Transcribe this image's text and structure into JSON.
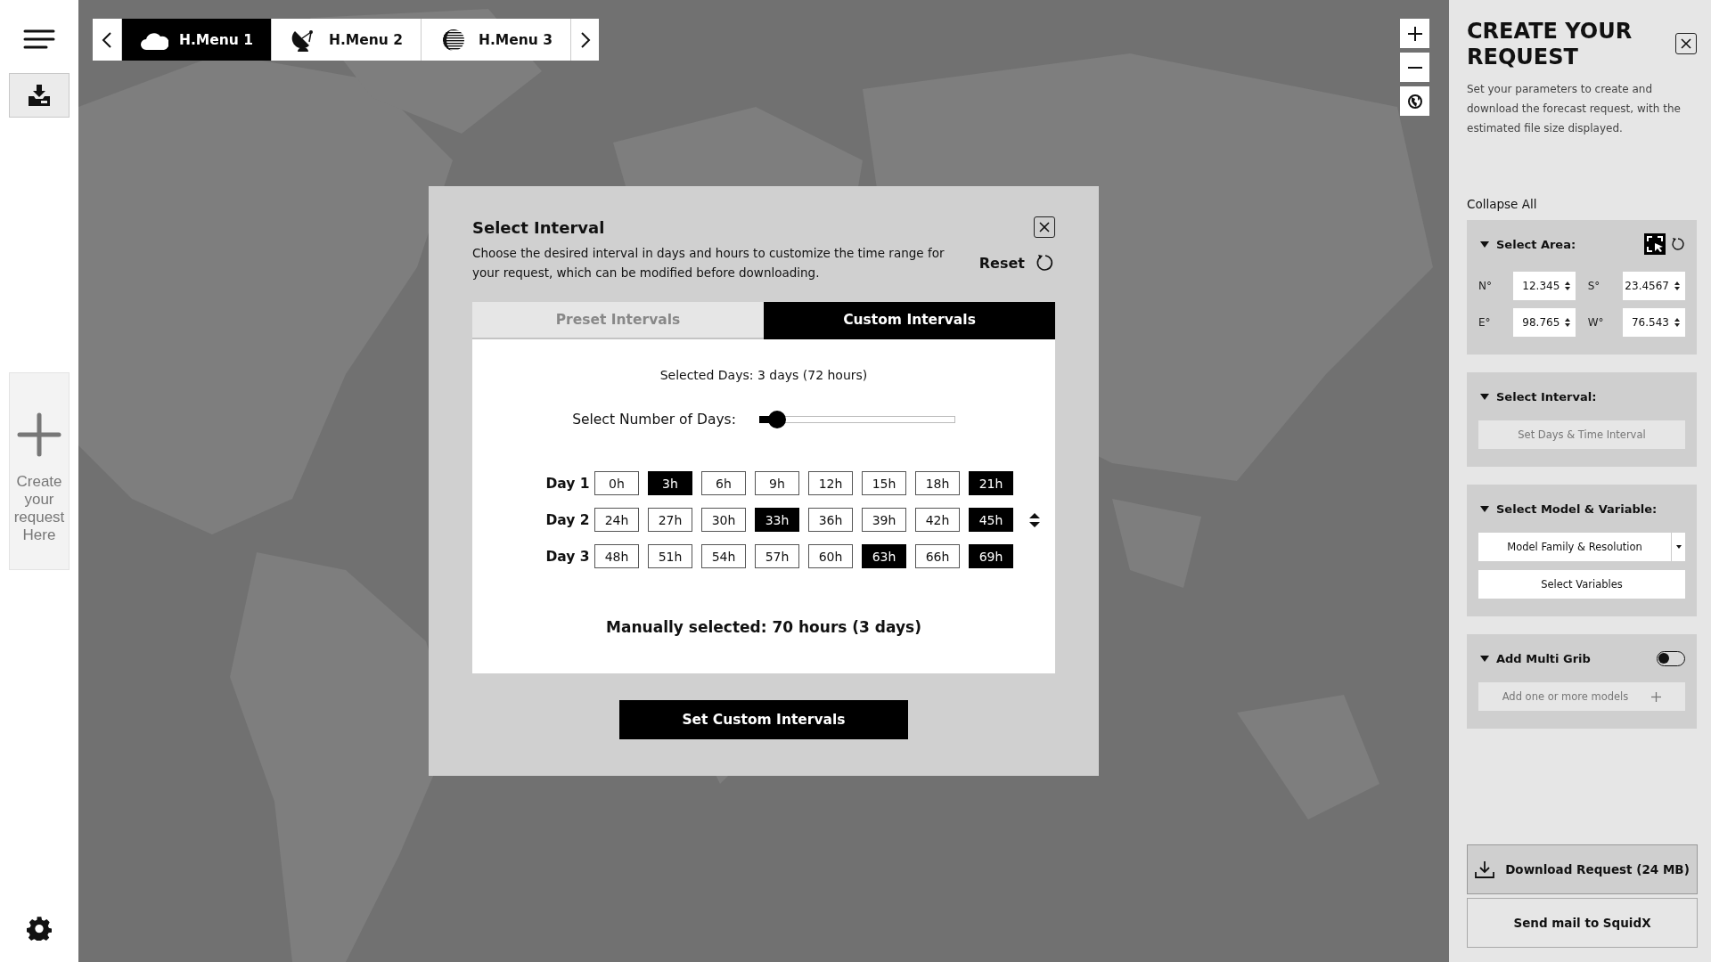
{
  "sidebar": {
    "create_card": {
      "label": "Create your request Here"
    }
  },
  "top_tabs": [
    {
      "label": "H.Menu 1",
      "selected": true
    },
    {
      "label": "H.Menu 2",
      "selected": false
    },
    {
      "label": "H.Menu 3",
      "selected": false
    }
  ],
  "modal": {
    "title": "Select Interval",
    "description": "Choose the desired interval in days and hours to customize the time range for your request, which can be modified before downloading.",
    "reset": "Reset",
    "tabs": [
      {
        "label": "Preset Intervals",
        "selected": false
      },
      {
        "label": "Custom Intervals",
        "selected": true
      }
    ],
    "selected_days": "Selected Days: 3 days (72 hours)",
    "slider": {
      "label": "Select Number of Days:",
      "level": 0.09
    },
    "days": [
      {
        "label": "Day 1",
        "hours": [
          {
            "label": "0h",
            "selected": false
          },
          {
            "label": "3h",
            "selected": true
          },
          {
            "label": "6h",
            "selected": false
          },
          {
            "label": "9h",
            "selected": false
          },
          {
            "label": "12h",
            "selected": false
          },
          {
            "label": "15h",
            "selected": false
          },
          {
            "label": "18h",
            "selected": false
          },
          {
            "label": "21h",
            "selected": true
          }
        ]
      },
      {
        "label": "Day 2",
        "hours": [
          {
            "label": "24h",
            "selected": false
          },
          {
            "label": "27h",
            "selected": false
          },
          {
            "label": "30h",
            "selected": false
          },
          {
            "label": "33h",
            "selected": true
          },
          {
            "label": "36h",
            "selected": false
          },
          {
            "label": "39h",
            "selected": false
          },
          {
            "label": "42h",
            "selected": false
          },
          {
            "label": "45h",
            "selected": true
          }
        ]
      },
      {
        "label": "Day 3",
        "hours": [
          {
            "label": "48h",
            "selected": false
          },
          {
            "label": "51h",
            "selected": false
          },
          {
            "label": "54h",
            "selected": false
          },
          {
            "label": "57h",
            "selected": false
          },
          {
            "label": "60h",
            "selected": false
          },
          {
            "label": "63h",
            "selected": true
          },
          {
            "label": "66h",
            "selected": false
          },
          {
            "label": "69h",
            "selected": true
          }
        ]
      }
    ],
    "summary": "Manually selected: 70 hours (3 days)",
    "button": "Set Custom Intervals"
  },
  "panel": {
    "title": "CREATE YOUR REQUEST",
    "description": "Set your parameters to create and download the forecast request, with the estimated file size displayed.",
    "collapse_all": "Collapse All",
    "sections": [
      {
        "kind": "area",
        "title": "Select Area:",
        "expanded": true,
        "fields": [
          {
            "label": "N°",
            "value": "12.345"
          },
          {
            "label": "S°",
            "value": "23.4567"
          },
          {
            "label": "E°",
            "value": "98.765"
          },
          {
            "label": "W°",
            "value": "76.543"
          }
        ]
      },
      {
        "kind": "interval",
        "title": "Select Interval:",
        "expanded": true,
        "button": "Set Days & Time Interval",
        "disabled": true
      },
      {
        "kind": "model",
        "title": "Select Model & Variable:",
        "expanded": true,
        "dropdown": "Model Family & Resolution",
        "button": "Select Variables"
      },
      {
        "kind": "multi",
        "title": "Add Multi Grib",
        "expanded": true,
        "on": false,
        "button": "Add one or more models",
        "disabled": true
      }
    ],
    "download_button": "Download Request (24 MB)",
    "mail_button": "Send mail to SquidX"
  }
}
